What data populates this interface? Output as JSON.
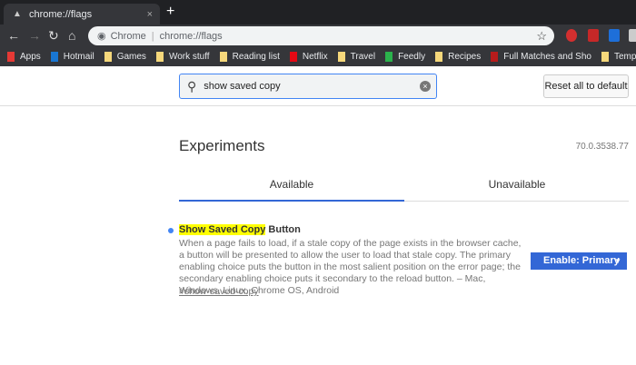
{
  "tab": {
    "title": "chrome://flags",
    "close": "×",
    "new_tab": "+"
  },
  "omnibox": {
    "site_label": "Chrome",
    "url": "chrome://flags"
  },
  "bookmarks": [
    {
      "label": "Apps",
      "icon": "apps-grid-icon"
    },
    {
      "label": "Hotmail",
      "icon": "outlook-icon"
    },
    {
      "label": "Games",
      "icon": "folder-icon"
    },
    {
      "label": "Work stuff",
      "icon": "folder-icon"
    },
    {
      "label": "Reading list",
      "icon": "folder-icon"
    },
    {
      "label": "Netflix",
      "icon": "netflix-icon"
    },
    {
      "label": "Travel",
      "icon": "folder-icon"
    },
    {
      "label": "Feedly",
      "icon": "feedly-icon"
    },
    {
      "label": "Recipes",
      "icon": "folder-icon"
    },
    {
      "label": "Full Matches and Sho",
      "icon": "site-icon"
    },
    {
      "label": "Temps",
      "icon": "folder-icon"
    }
  ],
  "search": {
    "value": "show saved copy"
  },
  "reset_label": "Reset all to default",
  "page_title": "Experiments",
  "version": "70.0.3538.77",
  "tabs": [
    {
      "label": "Available",
      "active": true
    },
    {
      "label": "Unavailable",
      "active": false
    }
  ],
  "flag": {
    "name_highlight": "Show Saved Copy",
    "name_rest": " Button",
    "description": "When a page fails to load, if a stale copy of the page exists in the browser cache, a button will be presented to allow the user to load that stale copy. The primary enabling choice puts the button in the most salient position on the error page; the secondary enabling choice puts it secondary to the reload button. – Mac, Windows, Linux, Chrome OS, Android",
    "link": "#show-saved-copy",
    "selected": "Enable: Primary"
  },
  "colors": {
    "accent": "#3367d6",
    "highlight": "#ffff00"
  }
}
